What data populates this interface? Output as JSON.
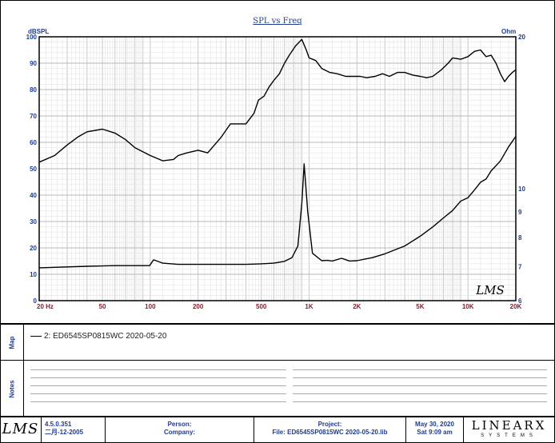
{
  "chart_data": {
    "type": "line",
    "title": "SPL vs Freq",
    "left_axis": {
      "label": "dBSPL",
      "min": 0,
      "max": 100,
      "ticks": [
        0,
        10,
        20,
        30,
        40,
        50,
        60,
        70,
        80,
        90,
        100
      ]
    },
    "right_axis": {
      "label": "Ohm",
      "scale": "log",
      "min": 6,
      "max": 20,
      "ticks": [
        6,
        7,
        8,
        9,
        10,
        20
      ]
    },
    "x_axis": {
      "scale": "log",
      "unit": "Hz",
      "min": 20,
      "max": 20000,
      "tick_values": [
        20,
        50,
        100,
        200,
        500,
        1000,
        2000,
        5000,
        10000,
        20000
      ],
      "tick_labels": [
        "20  Hz",
        "50",
        "100",
        "200",
        "500",
        "1K",
        "2K",
        "5K",
        "10K",
        "20K"
      ]
    },
    "grid": true,
    "series": [
      {
        "axis": "left",
        "color": "#000000",
        "points": [
          [
            20,
            52.5
          ],
          [
            25,
            55
          ],
          [
            30,
            59
          ],
          [
            35,
            62
          ],
          [
            40,
            64
          ],
          [
            50,
            65
          ],
          [
            60,
            63.5
          ],
          [
            70,
            61
          ],
          [
            80,
            58
          ],
          [
            100,
            55
          ],
          [
            120,
            53
          ],
          [
            140,
            53.5
          ],
          [
            150,
            55
          ],
          [
            170,
            56
          ],
          [
            200,
            57
          ],
          [
            230,
            56
          ],
          [
            280,
            62
          ],
          [
            320,
            67
          ],
          [
            400,
            67
          ],
          [
            450,
            71
          ],
          [
            480,
            76
          ],
          [
            520,
            77.5
          ],
          [
            560,
            81
          ],
          [
            600,
            83.5
          ],
          [
            650,
            86
          ],
          [
            700,
            90
          ],
          [
            750,
            93
          ],
          [
            820,
            96.5
          ],
          [
            900,
            99
          ],
          [
            960,
            95
          ],
          [
            1000,
            92
          ],
          [
            1100,
            91
          ],
          [
            1200,
            88
          ],
          [
            1350,
            86.5
          ],
          [
            1500,
            86
          ],
          [
            1700,
            85
          ],
          [
            1900,
            85
          ],
          [
            2100,
            85
          ],
          [
            2300,
            84.5
          ],
          [
            2600,
            85
          ],
          [
            2900,
            86
          ],
          [
            3200,
            85
          ],
          [
            3600,
            86.5
          ],
          [
            4000,
            86.5
          ],
          [
            4500,
            85.5
          ],
          [
            5000,
            85
          ],
          [
            5500,
            84.5
          ],
          [
            6000,
            85
          ],
          [
            6800,
            87.5
          ],
          [
            7500,
            90
          ],
          [
            8000,
            92
          ],
          [
            9000,
            91.5
          ],
          [
            10000,
            92.5
          ],
          [
            11000,
            94.5
          ],
          [
            12000,
            95
          ],
          [
            13000,
            92.5
          ],
          [
            14000,
            93
          ],
          [
            15000,
            90
          ],
          [
            16000,
            86
          ],
          [
            17000,
            83
          ],
          [
            18000,
            85
          ],
          [
            19000,
            86.5
          ],
          [
            20000,
            87.5
          ]
        ]
      },
      {
        "axis": "right",
        "color": "#000000",
        "points": [
          [
            20,
            6.97
          ],
          [
            40,
            7.02
          ],
          [
            60,
            7.04
          ],
          [
            99,
            7.04
          ],
          [
            105,
            7.23
          ],
          [
            120,
            7.12
          ],
          [
            150,
            7.08
          ],
          [
            200,
            7.08
          ],
          [
            300,
            7.08
          ],
          [
            400,
            7.08
          ],
          [
            500,
            7.1
          ],
          [
            600,
            7.12
          ],
          [
            700,
            7.18
          ],
          [
            780,
            7.3
          ],
          [
            850,
            7.7
          ],
          [
            900,
            9.35
          ],
          [
            930,
            11.2
          ],
          [
            980,
            9.0
          ],
          [
            1050,
            7.45
          ],
          [
            1200,
            7.2
          ],
          [
            1300,
            7.21
          ],
          [
            1400,
            7.19
          ],
          [
            1600,
            7.28
          ],
          [
            1800,
            7.19
          ],
          [
            2000,
            7.2
          ],
          [
            2500,
            7.3
          ],
          [
            3000,
            7.43
          ],
          [
            4000,
            7.7
          ],
          [
            5000,
            8.05
          ],
          [
            6000,
            8.4
          ],
          [
            7000,
            8.75
          ],
          [
            8000,
            9.05
          ],
          [
            9000,
            9.45
          ],
          [
            10000,
            9.6
          ],
          [
            11000,
            9.95
          ],
          [
            12000,
            10.3
          ],
          [
            13000,
            10.45
          ],
          [
            14000,
            10.85
          ],
          [
            16000,
            11.35
          ],
          [
            18000,
            12.1
          ],
          [
            20000,
            12.7
          ]
        ]
      }
    ]
  },
  "chart_logo": "LMS",
  "map": {
    "label": "Map",
    "legend_entry": "2: ED6545SP0815WC 2020-05-20"
  },
  "notes": {
    "label": "Notes"
  },
  "footer": {
    "logo": "LMS",
    "version": "4.5.0.351",
    "build_date": "二月-12-2005",
    "person_label": "Person:",
    "company_label": "Company:",
    "project_label": "Project:",
    "file_text": "File: ED6545SP0815WC 2020-05-20.lib",
    "date": "May 30, 2020",
    "time": "Sat  9:09 am",
    "brand_top": "LINEARX",
    "brand_bottom": "SYSTEMS"
  },
  "colors": {
    "axis_text": "#1f3c8f",
    "x_tick_text": "#8b1c2c",
    "grid": "#c8c8c8",
    "curve": "#000000"
  }
}
